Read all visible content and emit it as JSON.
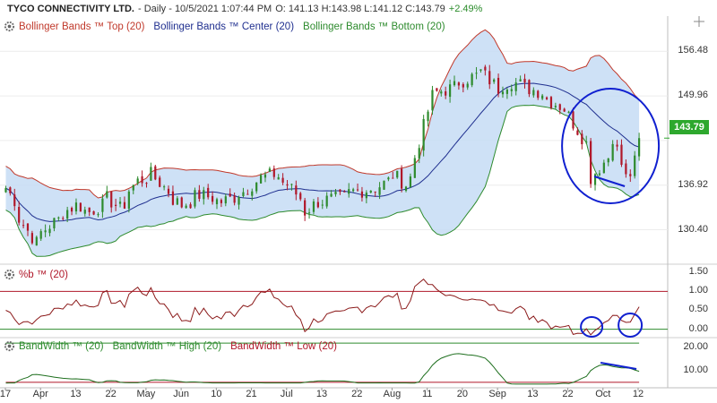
{
  "header": {
    "title": "TYCO CONNECTIVITY LTD.",
    "period": "- Daily - 10/5/2021 1:07:44 PM",
    "ohlc": "O: 141.13 H:143.98 L:141.12 C:143.79",
    "change": "+2.49%"
  },
  "colors": {
    "band_top": "#c0392b",
    "band_center": "#1f2f8f",
    "band_bottom": "#2e8b2e",
    "band_fill": "#c6dcf5",
    "up_candle": "#2e8b2e",
    "down_candle": "#b0182a",
    "annotation": "#1020d0",
    "price_tag": "#2ea82e"
  },
  "panels": {
    "price": {
      "legend": [
        "Bollinger Bands ™ Top (20)",
        "Bollinger Bands ™ Center (20)",
        "Bollinger Bands ™ Bottom (20)"
      ],
      "last_price": "143.79"
    },
    "pctb": {
      "legend": [
        "%b ™ (20)"
      ]
    },
    "bandwidth": {
      "legend": [
        "BandWidth ™ (20)",
        "BandWidth ™ High (20)",
        "BandWidth ™ Low (20)"
      ]
    }
  },
  "chart_data": [
    {
      "type": "candlestick",
      "title": "TYCO CONNECTIVITY LTD.",
      "yticks": [
        130.4,
        136.92,
        143.44,
        149.96,
        156.48
      ],
      "ytick_labels": [
        "130.40",
        "136.92",
        "",
        "149.96",
        "156.48"
      ],
      "ylim": [
        125.5,
        159.0
      ],
      "xtick_labels": [
        "17",
        "Apr",
        "13",
        "22",
        "May",
        "Jun",
        "10",
        "21",
        "Jul",
        "13",
        "22",
        "Aug",
        "11",
        "20",
        "Sep",
        "13",
        "22",
        "Oct",
        "12"
      ],
      "close_series_key": [
        [
          "2021-03-17",
          136.5
        ],
        [
          "2021-03-22",
          132.0
        ],
        [
          "2021-03-26",
          128.5
        ],
        [
          "2021-04-01",
          131.5
        ],
        [
          "2021-04-08",
          134.0
        ],
        [
          "2021-04-13",
          133.0
        ],
        [
          "2021-04-19",
          135.0
        ],
        [
          "2021-04-22",
          133.5
        ],
        [
          "2021-04-28",
          137.5
        ],
        [
          "2021-05-03",
          138.5
        ],
        [
          "2021-05-07",
          136.0
        ],
        [
          "2021-05-12",
          134.0
        ],
        [
          "2021-05-18",
          135.5
        ],
        [
          "2021-05-25",
          134.5
        ],
        [
          "2021-06-01",
          136.0
        ],
        [
          "2021-06-04",
          137.5
        ],
        [
          "2021-06-10",
          138.5
        ],
        [
          "2021-06-15",
          137.0
        ],
        [
          "2021-06-21",
          133.0
        ],
        [
          "2021-06-24",
          134.5
        ],
        [
          "2021-07-01",
          135.0
        ],
        [
          "2021-07-06",
          136.0
        ],
        [
          "2021-07-13",
          136.5
        ],
        [
          "2021-07-19",
          138.5
        ],
        [
          "2021-07-22",
          137.0
        ],
        [
          "2021-07-26",
          141.0
        ],
        [
          "2021-07-30",
          150.0
        ],
        [
          "2021-08-05",
          151.0
        ],
        [
          "2021-08-11",
          152.5
        ],
        [
          "2021-08-16",
          153.5
        ],
        [
          "2021-08-20",
          151.0
        ],
        [
          "2021-08-25",
          152.0
        ],
        [
          "2021-08-31",
          151.0
        ],
        [
          "2021-09-03",
          150.5
        ],
        [
          "2021-09-09",
          148.5
        ],
        [
          "2021-09-13",
          147.0
        ],
        [
          "2021-09-17",
          143.0
        ],
        [
          "2021-09-20",
          138.0
        ],
        [
          "2021-09-24",
          141.0
        ],
        [
          "2021-09-27",
          144.0
        ],
        [
          "2021-09-30",
          138.0
        ],
        [
          "2021-10-04",
          140.3
        ],
        [
          "2021-10-05",
          143.79
        ]
      ],
      "series": [
        {
          "name": "Bollinger Bands ™ Top (20)"
        },
        {
          "name": "Bollinger Bands ™ Center (20)"
        },
        {
          "name": "Bollinger Bands ™ Bottom (20)"
        }
      ],
      "last_value": 143.79
    },
    {
      "type": "line",
      "series": [
        {
          "name": "%b ™ (20)"
        }
      ],
      "yticks": [
        0.0,
        0.5,
        1.0,
        1.5
      ],
      "ytick_labels": [
        "0.00",
        "0.50",
        "1.00",
        "1.50"
      ],
      "ylim": [
        -0.2,
        1.65
      ],
      "reference_lines": [
        1.0,
        0.0
      ]
    },
    {
      "type": "line",
      "series": [
        {
          "name": "BandWidth ™ (20)"
        },
        {
          "name": "BandWidth ™ High (20)"
        },
        {
          "name": "BandWidth ™ Low (20)"
        }
      ],
      "yticks": [
        10.0,
        20.0
      ],
      "ytick_labels": [
        "10.00",
        "20.00"
      ],
      "ylim": [
        3.0,
        24.0
      ]
    }
  ]
}
